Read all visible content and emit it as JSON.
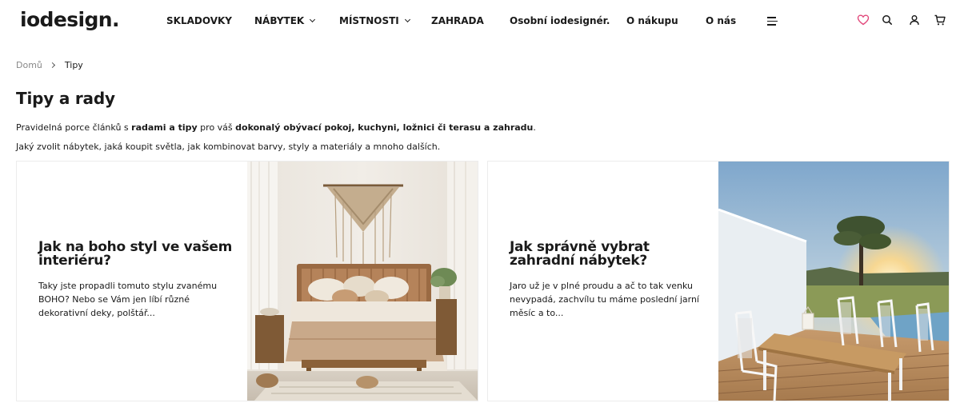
{
  "header": {
    "logo": {
      "prefix": "io",
      "suffix": "design."
    },
    "nav": [
      {
        "label": "SKLADOVKY",
        "has_dropdown": false
      },
      {
        "label": "NÁBYTEK",
        "has_dropdown": true
      },
      {
        "label": "MÍSTNOSTI",
        "has_dropdown": true
      },
      {
        "label": "ZAHRADA",
        "has_dropdown": false
      },
      {
        "label": "Osobní iodesignér.",
        "has_dropdown": false
      },
      {
        "label": "O nákupu",
        "has_dropdown": false
      },
      {
        "label": "O nás",
        "has_dropdown": false
      }
    ],
    "icons": [
      "menu-icon",
      "heart-icon",
      "search-icon",
      "user-icon",
      "cart-icon"
    ],
    "accent_color": "#e2477a"
  },
  "breadcrumb": {
    "home": "Domů",
    "current": "Tipy"
  },
  "page": {
    "title": "Tipy a rady",
    "intro1": {
      "p1": "Pravidelná porce článků s ",
      "b1": "radami a tipy",
      "p2": " pro váš ",
      "b2": "dokonalý obývací pokoj, kuchyni, ložnici či terasu a zahradu",
      "p3": "."
    },
    "intro2": "Jaký zvolit nábytek, jaká koupit světla, jak kombinovat barvy, styly a materiály a mnoho dalších."
  },
  "cards": [
    {
      "title": "Jak na boho styl ve vašem interiéru?",
      "desc": "Taky jste propadli tomuto stylu zvanému BOHO? Nebo se Vám jen líbí různé dekorativní deky, polštář...",
      "image": "bedroom-boho-photo"
    },
    {
      "title": "Jak správně vybrat zahradní nábytek?",
      "desc": "Jaro už je v plné proudu a ač to tak venku nevypadá, zachvílu tu máme poslední jarní měsíc a to...",
      "image": "garden-terrace-photo"
    }
  ]
}
